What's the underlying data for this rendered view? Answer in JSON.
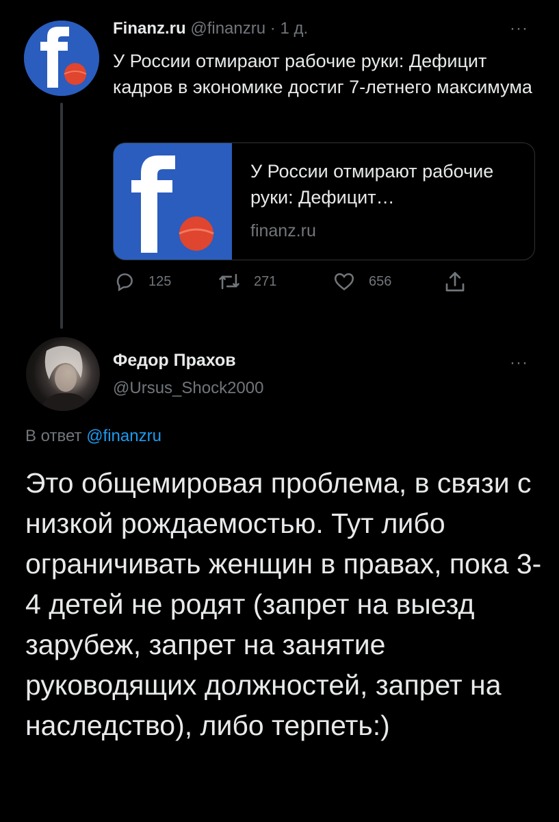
{
  "tweet1": {
    "author_name": "Finanz.ru",
    "author_handle": "@finanzru",
    "separator": "·",
    "time": "1 д.",
    "more_label": "···",
    "avatar_icon": "finanz-logo-icon",
    "text": "У России отмирают рабочие руки: Дефицит кадров в экономике достиг 7-летнего максимума",
    "card": {
      "title": "У России отмирают рабочие руки: Дефицит…",
      "domain": "finanz.ru",
      "image_icon": "finanz-logo-icon"
    },
    "actions": {
      "replies": "125",
      "retweets": "271",
      "likes": "656",
      "reply_icon": "reply-icon",
      "retweet_icon": "retweet-icon",
      "like_icon": "heart-icon",
      "share_icon": "share-icon"
    }
  },
  "tweet2": {
    "author_name": "Федор Прахов",
    "author_handle": "@Ursus_Shock2000",
    "more_label": "···",
    "reply_prefix": "В ответ",
    "reply_mention": "@finanzru",
    "text": "Это общемировая проблема, в связи с низкой рождаемостью. Тут либо ограничивать женщин в правах, пока 3-4 детей не родят (запрет на выезд зарубеж, запрет на занятие руководящих должностей, запрет на наследство), либо терпеть:)"
  },
  "colors": {
    "background": "#000000",
    "text": "#e7e9ea",
    "muted": "#71767b",
    "link": "#1d9bf0",
    "brand_blue": "#2a5dbd",
    "brand_red": "#e0452f"
  }
}
